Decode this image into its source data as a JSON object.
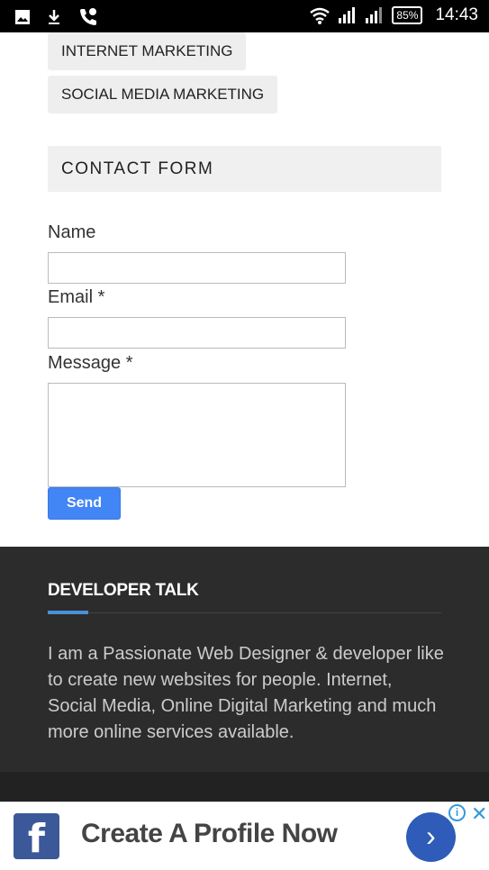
{
  "status": {
    "battery": "85%",
    "time": "14:43"
  },
  "tags": [
    "INTERNET MARKETING",
    "SOCIAL MEDIA MARKETING"
  ],
  "contact": {
    "title": "CONTACT FORM",
    "name_label": "Name",
    "email_label": "Email *",
    "message_label": "Message *",
    "send_label": "Send"
  },
  "footer": {
    "title": "DEVELOPER TALK",
    "text": "I am a Passionate Web Designer & developer like to create new websites for people. Internet, Social Media, Online Digital Marketing and much more online services available."
  },
  "ad": {
    "text": "Create A Profile Now",
    "logo": "f",
    "arrow": "›",
    "choice": "i",
    "close": "✕"
  }
}
